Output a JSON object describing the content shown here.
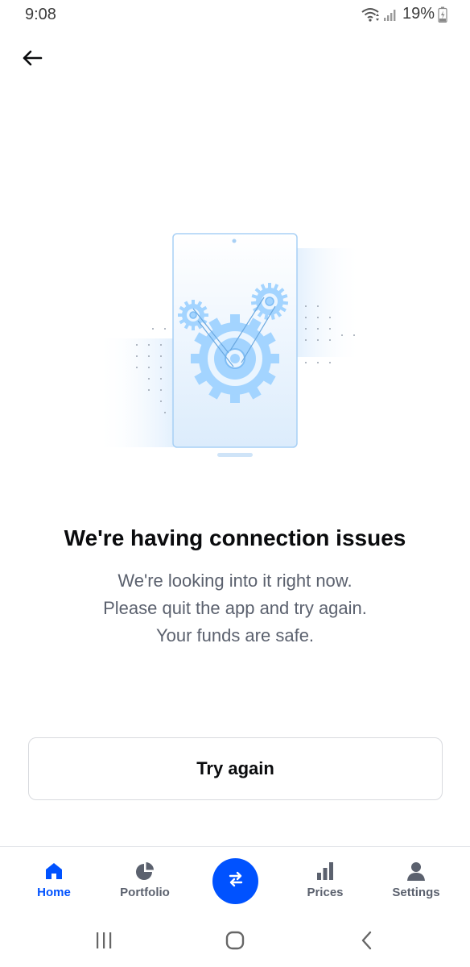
{
  "status_bar": {
    "time": "9:08",
    "battery": "19%",
    "icons": [
      "wifi-icon",
      "signal-icon",
      "battery-charging-icon"
    ]
  },
  "header": {
    "back_icon": "back-arrow-icon"
  },
  "illustration": {
    "name": "phone-with-gears-illustration",
    "colors": {
      "light": "#e8f3ff",
      "gear": "#a3d4ff",
      "outline": "#7fbdf5"
    }
  },
  "message": {
    "title": "We're having connection issues",
    "lines": [
      "We're looking into it right now.",
      "Please quit the app and try again.",
      "Your funds are safe."
    ]
  },
  "actions": {
    "try_again_label": "Try again"
  },
  "bottom_nav": {
    "items": [
      {
        "label": "Home",
        "icon": "home-icon",
        "active": true
      },
      {
        "label": "Portfolio",
        "icon": "pie-chart-icon",
        "active": false
      },
      {
        "label": "",
        "icon": "swap-arrows-icon",
        "active": false
      },
      {
        "label": "Prices",
        "icon": "bar-chart-icon",
        "active": false
      },
      {
        "label": "Settings",
        "icon": "person-icon",
        "active": false
      }
    ],
    "accent": "#0052ff",
    "inactive": "#5b616e"
  },
  "system_nav": {
    "buttons": [
      "recent-apps-icon",
      "home-circle-icon",
      "back-chevron-icon"
    ]
  }
}
